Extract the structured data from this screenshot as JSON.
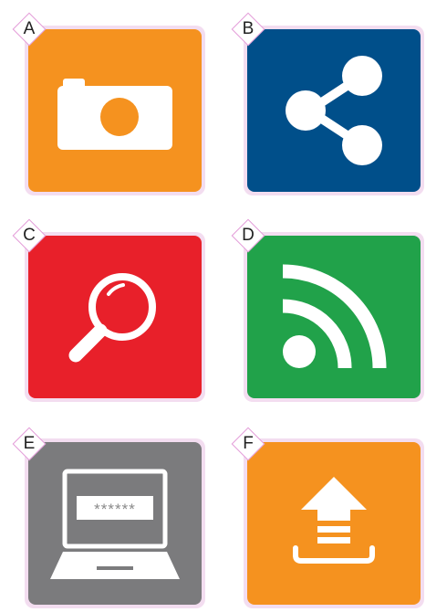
{
  "tiles": [
    {
      "letter": "A",
      "icon": "camera-icon",
      "color": "#f5921f"
    },
    {
      "letter": "B",
      "icon": "share-icon",
      "color": "#004f8a"
    },
    {
      "letter": "C",
      "icon": "search-icon",
      "color": "#e8202a"
    },
    {
      "letter": "D",
      "icon": "rss-icon",
      "color": "#21a24a"
    },
    {
      "letter": "E",
      "icon": "laptop-password-icon",
      "color": "#7b7b7d",
      "password_mask": "******"
    },
    {
      "letter": "F",
      "icon": "upload-icon",
      "color": "#f5921f"
    }
  ],
  "frame_color": "#f3ddf0",
  "badge_border_color": "#e39ad8"
}
